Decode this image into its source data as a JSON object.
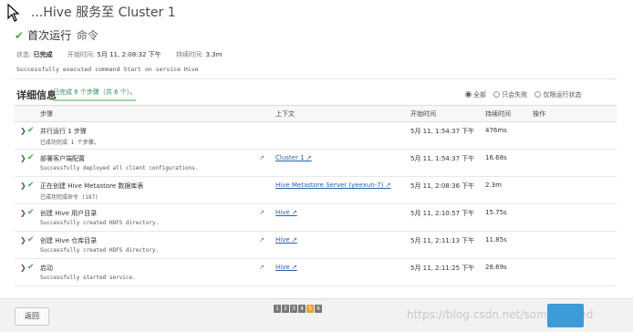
{
  "header": {
    "title": "...Hive 服务至 Cluster 1",
    "subtitle": "首次运行",
    "subtitle_cmd": "命令"
  },
  "status": {
    "state_label": "状态:",
    "state_value": "已完成",
    "start_label": "开始时间:",
    "start_value": "5月 11, 2:08:32 下午",
    "duration_label": "持续时间:",
    "duration_value": "3.3m"
  },
  "result_text": "Successfully executed command Start on service Hive",
  "details": {
    "title": "详细信息",
    "steps_done": "已完成 6 个步骤（共 6 个）。",
    "filters": [
      "全部",
      "只会失败",
      "仅限运行状态"
    ]
  },
  "table": {
    "headers": [
      "步骤",
      "上下文",
      "开始时间",
      "持续时间",
      "操作"
    ],
    "rows": [
      {
        "name": "并行运行 1 步骤",
        "msg": "已成功完成 1 个步骤。",
        "ext": "",
        "ctx": "",
        "start": "5月 11, 1:54:37 下午",
        "dur": "476ms"
      },
      {
        "name": "部署客户端配置",
        "msg": "Successfully deployed all client configurations.",
        "ext": "↗",
        "ctx": "Cluster 1 ↗",
        "start": "5月 11, 1:54:37 下午",
        "dur": "16.68s"
      },
      {
        "name": "正在创建 Hive Metastore 数据库表",
        "msg": "已成功完成命令 (187)",
        "ext": "",
        "ctx": "Hive Metastore Server (yeexun-7) ↗",
        "start": "5月 11, 2:08:36 下午",
        "dur": "2.3m"
      },
      {
        "name": "创建 Hive 用户目录",
        "msg": "Successfully created HDFS directory.",
        "ext": "↗",
        "ctx": "Hive ↗",
        "start": "5月 11, 2:10:57 下午",
        "dur": "15.75s"
      },
      {
        "name": "创建 Hive 仓库目录",
        "msg": "Successfully created HDFS directory.",
        "ext": "↗",
        "ctx": "Hive ↗",
        "start": "5月 11, 2:11:13 下午",
        "dur": "11.85s"
      },
      {
        "name": "启动",
        "msg": "Successfully started service.",
        "ext": "↗",
        "ctx": "Hive ↗",
        "start": "5月 11, 2:11:25 下午",
        "dur": "28.69s"
      }
    ]
  },
  "footer": {
    "back_label": "返回",
    "pages": [
      "1",
      "2",
      "3",
      "4",
      "5",
      "6"
    ],
    "current_page": "5",
    "watermark": "https://blog.csdn.net/someLnileed"
  },
  "colors": {
    "success": "#48a94a",
    "link": "#2a5ea8",
    "primary_button": "#3d9bd8",
    "current_page": "#e9a13a"
  },
  "icons": {
    "check": "check-icon",
    "chevron": "chevron-right-icon",
    "external": "external-link-icon",
    "cursor": "mouse-cursor-icon"
  }
}
